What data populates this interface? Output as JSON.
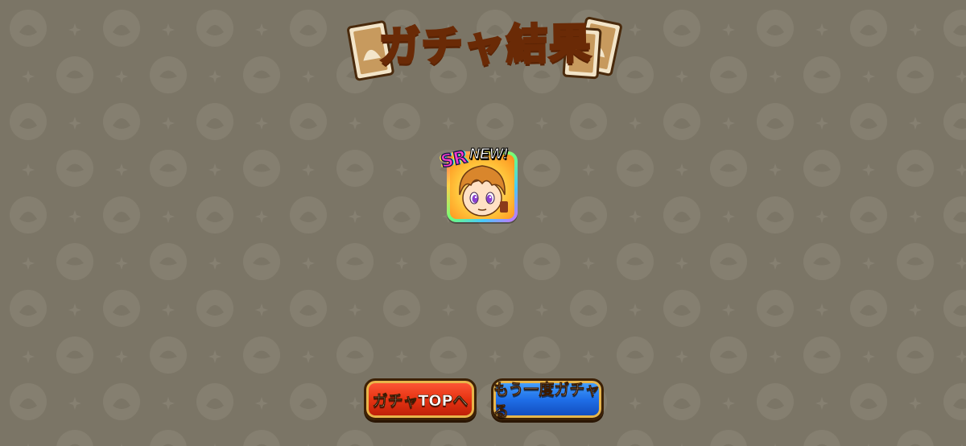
{
  "screen": {
    "title": "ガチャ結果"
  },
  "result": {
    "rarity_badge": "SR",
    "new_badge": "NEW!",
    "character_icon": "character-portrait"
  },
  "buttons": {
    "gacha_top": "ガチャTOPへ",
    "gacha_again": "もう一度ガチャる"
  },
  "colors": {
    "background": "#7b7566",
    "title_fill": "#ffb020",
    "title_outline": "#6a2a06",
    "button_red": "#e63312",
    "button_blue": "#1f6fe8",
    "button_border": "#3d2105"
  }
}
